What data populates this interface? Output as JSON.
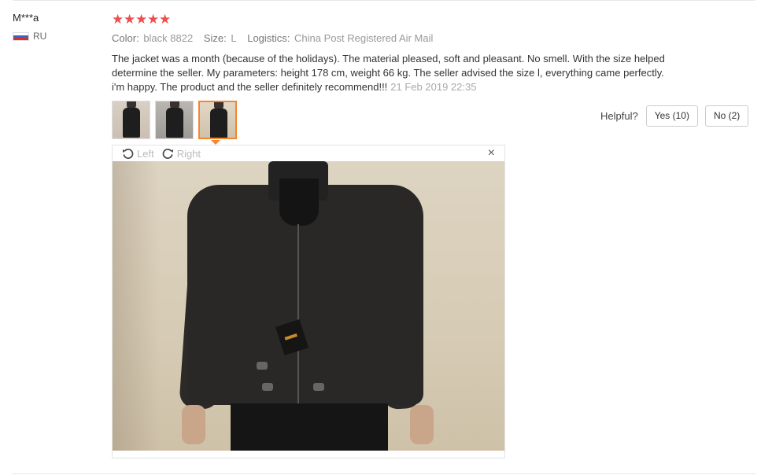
{
  "reviewer": {
    "name": "M***a",
    "country": "RU"
  },
  "rating": {
    "stars": 5,
    "max": 5,
    "star_glyph": "★",
    "color": "#f04d4d"
  },
  "meta": {
    "color_label": "Color:",
    "color_value": "black 8822",
    "size_label": "Size:",
    "size_value": "L",
    "logistics_label": "Logistics:",
    "logistics_value": "China Post Registered Air Mail"
  },
  "feedback": {
    "text": "The jacket was a month (because of the holidays). The material pleased, soft and pleasant. No smell. With the size helped determine the seller. My parameters: height 178 cm, weight 66 kg. The seller advised the size l, everything came perfectly. i'm happy. The product and the seller definitely recommend!!!",
    "date": "21 Feb 2019 22:35"
  },
  "thumbnails": [
    {
      "name": "photo-1",
      "active": false
    },
    {
      "name": "photo-2",
      "active": false
    },
    {
      "name": "photo-3",
      "active": true
    }
  ],
  "helpful": {
    "label": "Helpful?",
    "yes_label": "Yes (10)",
    "no_label": "No (2)"
  },
  "viewer": {
    "rotate_left_label": "Left",
    "rotate_right_label": "Right",
    "close_glyph": "×",
    "icons": [
      "rotate-left-icon",
      "rotate-right-icon",
      "close-icon"
    ]
  },
  "colors": {
    "accent": "#f5852f",
    "star": "#f04d4d",
    "muted": "#999999"
  }
}
